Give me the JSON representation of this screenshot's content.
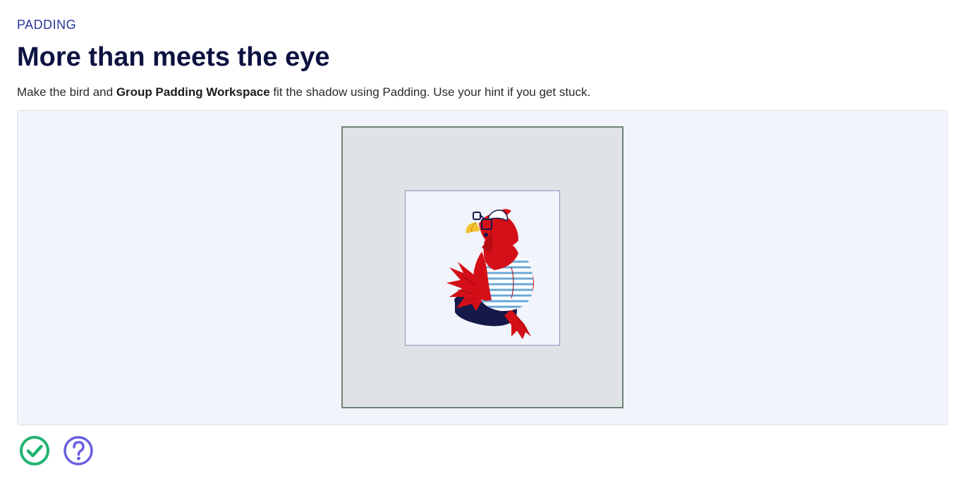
{
  "header": {
    "eyebrow": "PADDING",
    "title": "More than meets the eye"
  },
  "instructions": {
    "before": "Make the bird and ",
    "emphasis": "Group Padding Workspace",
    "after": " fit the shadow using Padding. Use your hint if you get stuck."
  },
  "controls": {
    "check_icon": "check-circle-icon",
    "hint_icon": "question-circle-icon"
  },
  "colors": {
    "accent": "#28399b",
    "title": "#0d1240",
    "stage_bg": "#f1f4fa",
    "shadow_fill": "#e0e3e6",
    "shadow_border": "#6f8177",
    "check": "#22b573",
    "hint": "#6a5fe0",
    "bird_red": "#d40f17",
    "stripe_blue": "#6aa7d6",
    "cushion_navy": "#14194a"
  }
}
